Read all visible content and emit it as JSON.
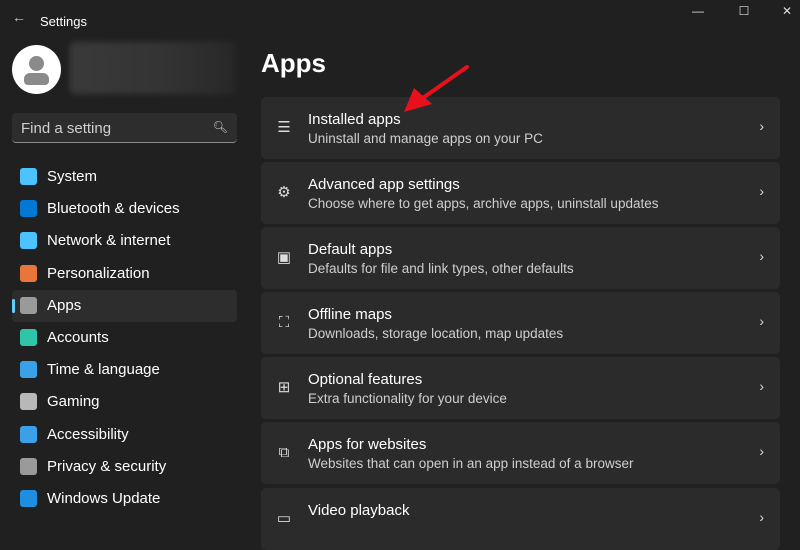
{
  "window": {
    "title": "Settings",
    "back": "←",
    "minimize": "—",
    "maximize": "☐",
    "close": "✕"
  },
  "search": {
    "placeholder": "Find a setting",
    "icon": "search-icon"
  },
  "sidebar": {
    "items": [
      {
        "label": "System",
        "color": "#4cc2ff"
      },
      {
        "label": "Bluetooth & devices",
        "color": "#0078d4"
      },
      {
        "label": "Network & internet",
        "color": "#4cc2ff"
      },
      {
        "label": "Personalization",
        "color": "#e8763a"
      },
      {
        "label": "Apps",
        "color": "#9a9a9a",
        "active": true
      },
      {
        "label": "Accounts",
        "color": "#2ec5a8"
      },
      {
        "label": "Time & language",
        "color": "#3aa0e8"
      },
      {
        "label": "Gaming",
        "color": "#b8b8b8"
      },
      {
        "label": "Accessibility",
        "color": "#3aa0e8"
      },
      {
        "label": "Privacy & security",
        "color": "#9a9a9a"
      },
      {
        "label": "Windows Update",
        "color": "#1f8de0"
      }
    ]
  },
  "page": {
    "title": "Apps"
  },
  "cards": [
    {
      "title": "Installed apps",
      "subtitle": "Uninstall and manage apps on your PC",
      "icon": "☰"
    },
    {
      "title": "Advanced app settings",
      "subtitle": "Choose where to get apps, archive apps, uninstall updates",
      "icon": "⚙"
    },
    {
      "title": "Default apps",
      "subtitle": "Defaults for file and link types, other defaults",
      "icon": "▣"
    },
    {
      "title": "Offline maps",
      "subtitle": "Downloads, storage location, map updates",
      "icon": "⛶"
    },
    {
      "title": "Optional features",
      "subtitle": "Extra functionality for your device",
      "icon": "⊞"
    },
    {
      "title": "Apps for websites",
      "subtitle": "Websites that can open in an app instead of a browser",
      "icon": "⧉"
    },
    {
      "title": "Video playback",
      "subtitle": "",
      "icon": "▭"
    }
  ],
  "chevron": "›"
}
